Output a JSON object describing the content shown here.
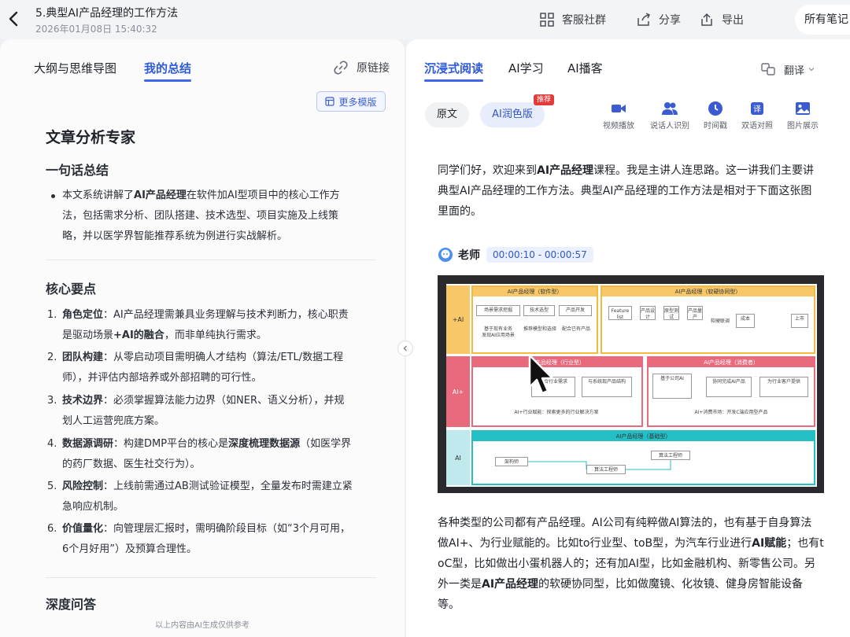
{
  "header": {
    "title": "5.典型AI产品经理的工作方法",
    "datetime": "2026年01月08日 15:40:32",
    "community_label": "客服社群",
    "share_label": "分享",
    "export_label": "导出",
    "all_notes_label": "所有笔记"
  },
  "left": {
    "tabs": [
      {
        "label": "大纲与思维导图",
        "active": false
      },
      {
        "label": "我的总结",
        "active": true
      }
    ],
    "source_link_label": "原链接",
    "more_templates_label": "更多模版",
    "heading": "文章分析专家",
    "one_line_title": "一句话总结",
    "one_line": {
      "p1": "本文系统讲解了",
      "b1": "AI产品经理",
      "p2": "在软件加AI型项目中的核心工作方",
      "l2": "法，包括需求分析、团队搭建、技术选型、项目实施及上线策",
      "l3": "略，并以医学界智能推荐系统为例进行实战解析。"
    },
    "key_points_title": "核心要点",
    "points": [
      {
        "num": "1.",
        "title": "角色定位",
        "l1": "：AI产品经理需兼具业务理解与技术判断力，核心职责",
        "l2a": "是驱动场景",
        "l2b": "+AI的融合",
        "l2c": "，而非单纯执行需求。"
      },
      {
        "num": "2.",
        "title": "团队构建",
        "l1": "：从零启动项目需明确人才结构（算法/ETL/数据工程",
        "l2": "师），并评估内部培养或外部招聘的可行性。"
      },
      {
        "num": "3.",
        "title": "技术边界",
        "l1": "：必须掌握算法能力边界（如NER、语义分析），并规",
        "l2": "划人工运营兜底方案。"
      },
      {
        "num": "4.",
        "title": "数据源调研",
        "l1a": "：构建DMP平台的核心是",
        "l1b": "深度梳理数据源",
        "l1c": "（如医学界",
        "l2": "的药厂数据、医生社交行为）。"
      },
      {
        "num": "5.",
        "title": "风险控制",
        "l1": "：上线前需通过AB测试验证模型，全量发布时需建立紧",
        "l2": "急响应机制。"
      },
      {
        "num": "6.",
        "title": "价值量化",
        "l1": "：向管理层汇报时，需明确阶段目标（如“3个月可用，",
        "l2": "6个月好用”）及预算合理性。"
      }
    ],
    "deep_qa_title": "深度问答",
    "footnote": "以上内容由AI生成仅供参考"
  },
  "right": {
    "tabs": [
      {
        "label": "沉浸式阅读",
        "active": true
      },
      {
        "label": "AI学习",
        "active": false
      },
      {
        "label": "AI播客",
        "active": false
      }
    ],
    "translate_label": "翻译",
    "mode_original": "原文",
    "mode_ai": "AI润色版",
    "recommend_badge": "推荐",
    "tools": [
      "视频播放",
      "说话人识别",
      "时间戳",
      "双语对照",
      "图片展示"
    ],
    "intro": {
      "a": "同学们好，欢迎来到",
      "b": "AI产品经理",
      "c": "课程。我是主讲人连思路。这一讲我们主要讲",
      "l2": "典型AI产品经理的工作方法。典型AI产品经理的工作方法是相对于下面这张图",
      "l3": "里面的。"
    },
    "speaker_name": "老师",
    "speaker_time": "00:00:10 - 00:00:57",
    "outro": {
      "l1": "各种类型的公司都有产品经理。AI公司有纯粹做AI算法的，也有基于自身算法",
      "l2a": "做AI+、为行业赋能的。比如to行业型、toB型，为汽车行业进行",
      "l2b": "AI赋能",
      "l2c": "；也有t",
      "l3": "oC型，比如做出小蛋机器人的；还有加AI型，比如金融机构、新零售公司。另",
      "l4a": "外一类是",
      "l4b": "AI产品经理",
      "l4c": "的软硬协同型，比如做魔镜、化妆镜、健身房智能设备",
      "l5": "等。"
    },
    "slide": {
      "row1_side": "+AI",
      "row1_left_title": "AI产品经理（软件型）",
      "row1_right_title": "AI产品经理（软硬协同型）",
      "row1_boxes": [
        "场景需求挖掘",
        "技术选型",
        "产品开发"
      ],
      "row1_note_a": "基于现有业务",
      "row1_note_b": "发现AI应用场景",
      "row1_note_c": "推荐模型和选择",
      "row1_note_d": "配合已有产品",
      "row1_flow": [
        "Feature list",
        "产品设计",
        "原型测试",
        "产品量产",
        "软硬联调",
        "成本",
        "上市"
      ],
      "row2_side": "AI+",
      "row2_left_title": "AI产品经理（行业型）",
      "row2_right_title": "AI产品经理（消费者）",
      "row2_boxes": [
        "融合行业需求",
        "与系统现产品结构",
        "基于公司AI",
        "协同完成AI产品",
        "为行业客户提供"
      ],
      "row2_left_note": "AI+行业赋能：探索更多的行业解决方案",
      "row2_right_note": "AI+消费市场：开发C端应用型产品",
      "row3_side": "AI",
      "row3_title": "AI产品经理（基础型）",
      "row3_boxes": [
        "算法工程师",
        "架构师",
        "算法工程师"
      ]
    }
  }
}
